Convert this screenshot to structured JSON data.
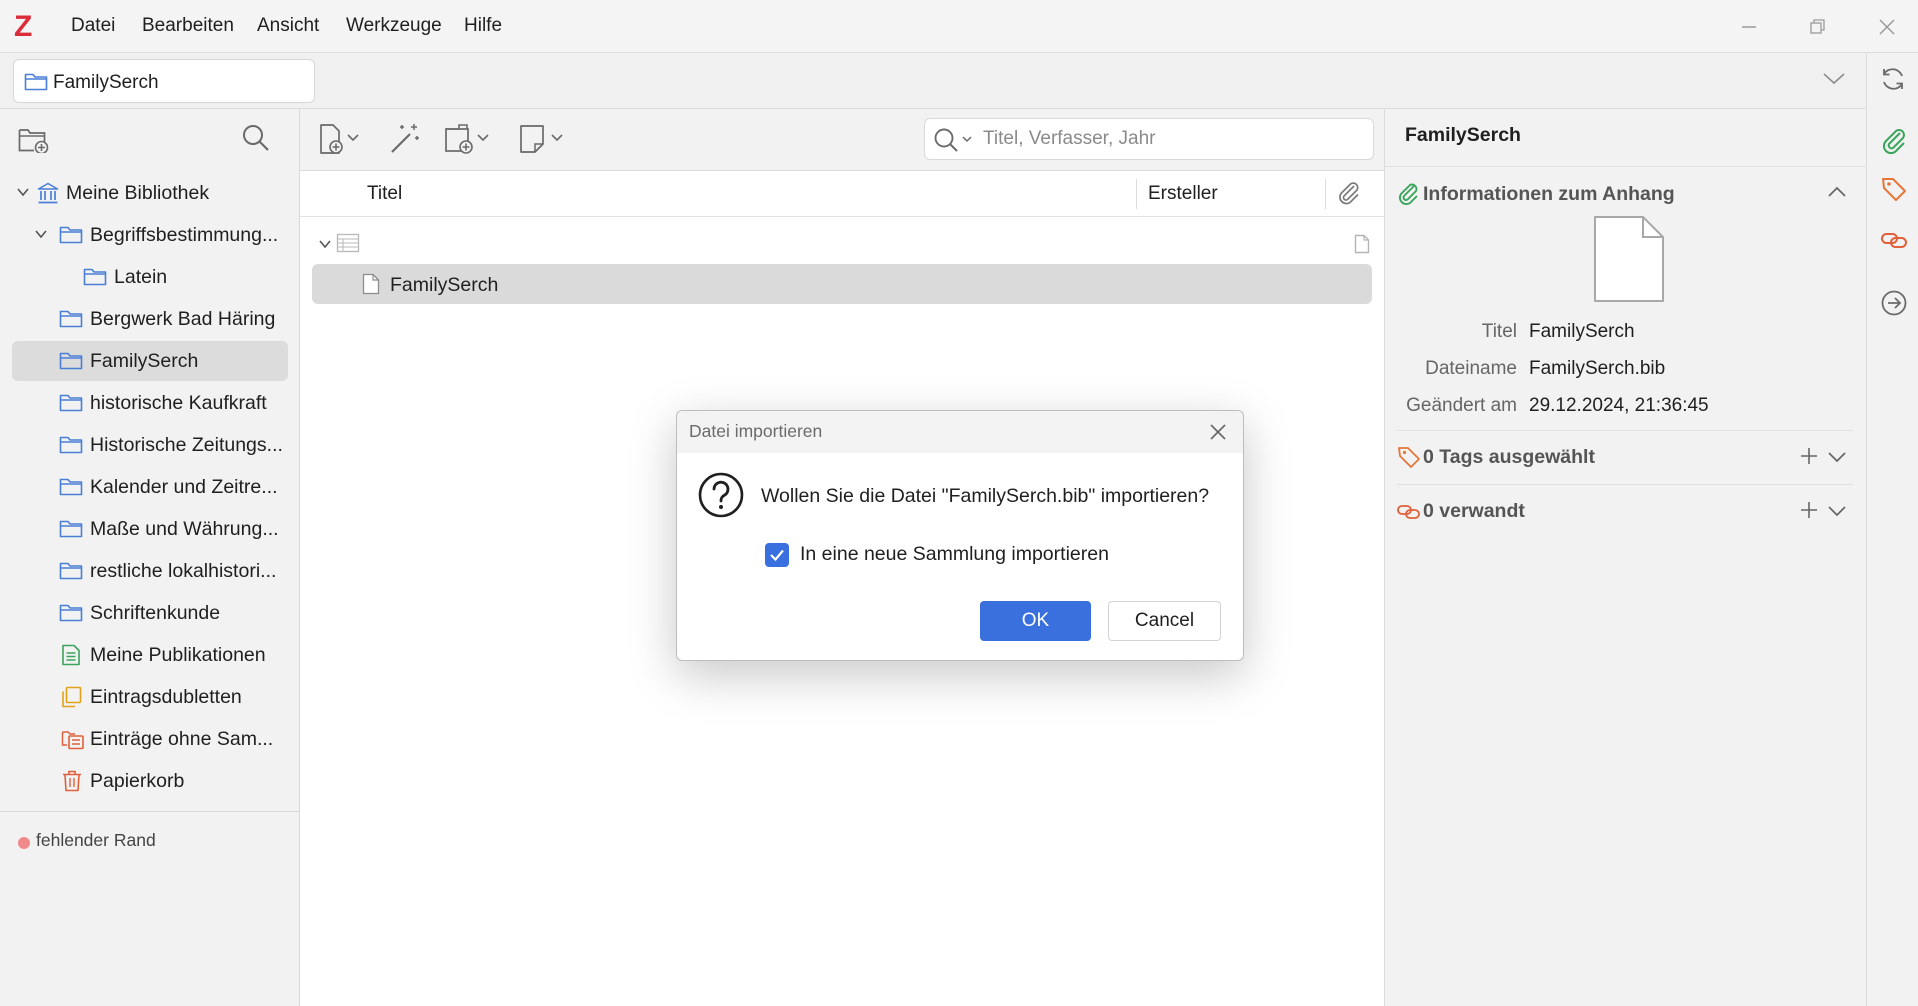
{
  "app": {
    "logo": "Z"
  },
  "menu": [
    "Datei",
    "Bearbeiten",
    "Ansicht",
    "Werkzeuge",
    "Hilfe"
  ],
  "tab": {
    "label": "FamilySerch"
  },
  "collections": {
    "library": "Meine Bibliothek",
    "items": [
      {
        "label": "Begriffsbestimmung...",
        "icon": "folder-icon"
      },
      {
        "label": "Latein",
        "icon": "folder-icon"
      },
      {
        "label": "Bergwerk Bad Häring",
        "icon": "folder-icon"
      },
      {
        "label": "FamilySerch",
        "icon": "folder-icon",
        "selected": true
      },
      {
        "label": "historische Kaufkraft",
        "icon": "folder-icon"
      },
      {
        "label": "Historische Zeitungs...",
        "icon": "folder-icon"
      },
      {
        "label": "Kalender und Zeitre...",
        "icon": "folder-icon"
      },
      {
        "label": "Maße und Währung...",
        "icon": "folder-icon"
      },
      {
        "label": "restliche lokalhistori...",
        "icon": "folder-icon"
      },
      {
        "label": "Schriftenkunde",
        "icon": "folder-icon"
      },
      {
        "label": "Meine Publikationen",
        "icon": "publications-icon"
      },
      {
        "label": "Eintragsdubletten",
        "icon": "duplicates-icon"
      },
      {
        "label": "Einträge ohne Sam...",
        "icon": "unfiled-icon"
      },
      {
        "label": "Papierkorb",
        "icon": "trash-icon"
      }
    ],
    "tag": "fehlender Rand"
  },
  "search": {
    "placeholder": "Titel, Verfasser, Jahr"
  },
  "columns": {
    "title": "Titel",
    "creator": "Ersteller"
  },
  "items": [
    {
      "title": ""
    },
    {
      "title": "FamilySerch",
      "selected": true
    }
  ],
  "item_pane": {
    "title": "FamilySerch",
    "attachment_section": "Informationen zum Anhang",
    "fields": [
      {
        "label": "Titel",
        "value": "FamilySerch"
      },
      {
        "label": "Dateiname",
        "value": "FamilySerch.bib"
      },
      {
        "label": "Geändert am",
        "value": "29.12.2024, 21:36:45"
      }
    ],
    "tags_section": "0 Tags ausgewählt",
    "related_section": "0 verwandt"
  },
  "dialog": {
    "title": "Datei importieren",
    "message": "Wollen Sie die Datei \"FamilySerch.bib\" importieren?",
    "checkbox_label": "In eine neue Sammlung importieren",
    "checkbox_checked": true,
    "ok": "OK",
    "cancel": "Cancel"
  },
  "colors": {
    "accent": "#3a70dd",
    "folder": "#4a7fd6",
    "attachment_green": "#3aa55c",
    "tag_orange": "#e5763a",
    "related_orange": "#e0603a",
    "logo_red": "#db2c3a"
  }
}
